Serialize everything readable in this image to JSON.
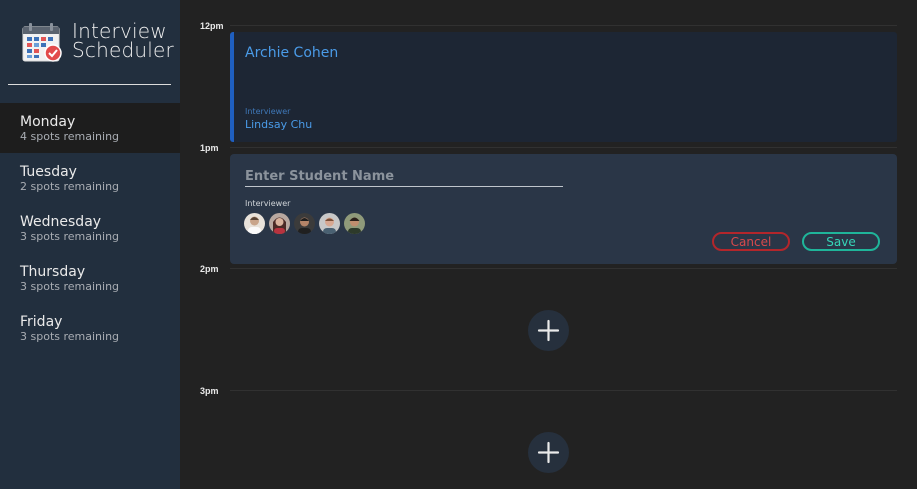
{
  "app": {
    "title_line1": "Interview",
    "title_line2": "Scheduler",
    "logo_icon": "calendar-check-icon"
  },
  "sidebar": {
    "days": [
      {
        "name": "Monday",
        "spots": "4 spots remaining",
        "selected": true
      },
      {
        "name": "Tuesday",
        "spots": "2 spots remaining",
        "selected": false
      },
      {
        "name": "Wednesday",
        "spots": "3 spots remaining",
        "selected": false
      },
      {
        "name": "Thursday",
        "spots": "3 spots remaining",
        "selected": false
      },
      {
        "name": "Friday",
        "spots": "3 spots remaining",
        "selected": false
      }
    ]
  },
  "schedule": {
    "times": [
      "12pm",
      "1pm",
      "2pm",
      "3pm"
    ],
    "booked": {
      "student": "Archie Cohen",
      "interviewer_label": "Interviewer",
      "interviewer": "Lindsay Chu"
    },
    "form": {
      "name_placeholder": "Enter Student Name",
      "name_value": "",
      "interviewer_label": "Interviewer",
      "cancel_label": "Cancel",
      "save_label": "Save"
    },
    "add_icon": "plus-icon"
  },
  "colors": {
    "accent_blue": "#4a9be8",
    "cancel_red": "#d9494c",
    "save_green": "#36d6b8",
    "sidebar_bg": "#222f3e"
  }
}
